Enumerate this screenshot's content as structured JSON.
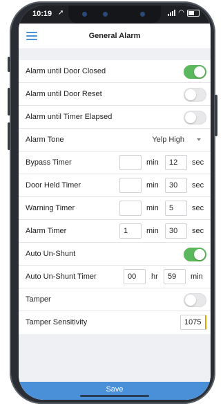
{
  "status_bar": {
    "time": "10:19",
    "location_icon": "location-arrow-icon",
    "signal_icon": "signal-bars-icon",
    "wifi_icon": "wifi-icon",
    "battery_icon": "battery-icon"
  },
  "header": {
    "title": "General Alarm",
    "menu_icon": "hamburger-menu-icon"
  },
  "rows": {
    "alarm_until_door_closed": {
      "label": "Alarm until Door Closed",
      "on": true
    },
    "alarm_until_door_reset": {
      "label": "Alarm until Door Reset",
      "on": false
    },
    "alarm_until_timer_elapsed": {
      "label": "Alarm until Timer Elapsed",
      "on": false
    },
    "alarm_tone": {
      "label": "Alarm Tone",
      "value": "Yelp High"
    },
    "bypass_timer": {
      "label": "Bypass Timer",
      "min": "",
      "min_unit": "min",
      "sec": "12",
      "sec_unit": "sec"
    },
    "door_held_timer": {
      "label": "Door Held Timer",
      "min": "",
      "min_unit": "min",
      "sec": "30",
      "sec_unit": "sec"
    },
    "warning_timer": {
      "label": "Warning Timer",
      "min": "",
      "min_unit": "min",
      "sec": "5",
      "sec_unit": "sec"
    },
    "alarm_timer": {
      "label": "Alarm Timer",
      "min": "1",
      "min_unit": "min",
      "sec": "30",
      "sec_unit": "sec"
    },
    "auto_un_shunt": {
      "label": "Auto Un-Shunt",
      "on": true
    },
    "auto_un_shunt_timer": {
      "label": "Auto Un-Shunt Timer",
      "hr": "00",
      "hr_unit": "hr",
      "min": "59",
      "min_unit": "min"
    },
    "tamper": {
      "label": "Tamper",
      "on": false
    },
    "tamper_sensitivity": {
      "label": "Tamper Sensitivity",
      "value": "1075"
    }
  },
  "footer": {
    "save_label": "Save"
  },
  "colors": {
    "accent": "#4a90d9",
    "toggle_on": "#5cb85c",
    "background": "#eff0f4"
  }
}
